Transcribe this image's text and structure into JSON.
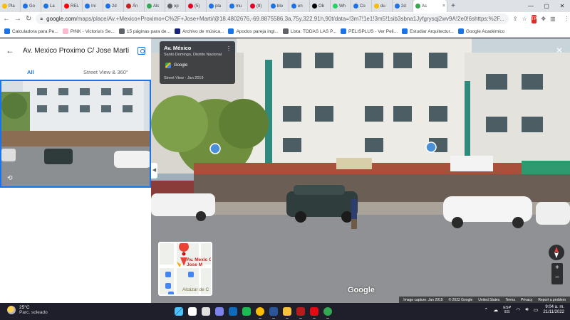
{
  "browser": {
    "tabs": [
      {
        "label": "Pla",
        "color": "#fbbc04"
      },
      {
        "label": "Go",
        "color": "#1a73e8"
      },
      {
        "label": "La",
        "color": "#1a73e8"
      },
      {
        "label": "REL",
        "color": "#ff0000"
      },
      {
        "label": "Ini",
        "color": "#1a73e8"
      },
      {
        "label": "2d",
        "color": "#1a73e8"
      },
      {
        "label": "Án",
        "color": "#c5221f"
      },
      {
        "label": "Alc",
        "color": "#34a853"
      },
      {
        "label": "op",
        "color": "#5f6368"
      },
      {
        "label": "(5)",
        "color": "#e60023"
      },
      {
        "label": "pla",
        "color": "#1a73e8"
      },
      {
        "label": "mu",
        "color": "#1a73e8"
      },
      {
        "label": "(8)",
        "color": "#e60023"
      },
      {
        "label": "blo",
        "color": "#1a73e8"
      },
      {
        "label": "en",
        "color": "#1a73e8"
      },
      {
        "label": "Ob",
        "color": "#000000"
      },
      {
        "label": "Wh",
        "color": "#25d366"
      },
      {
        "label": "Co",
        "color": "#1a73e8"
      },
      {
        "label": "du",
        "color": "#fbbc04"
      },
      {
        "label": "2d",
        "color": "#1a73e8"
      },
      {
        "label": "As",
        "color": "#34a853"
      }
    ],
    "active_tab_color": "#34a853",
    "new_tab": "+",
    "window_controls": {
      "minimize": "—",
      "maximize": "▢",
      "close": "✕"
    },
    "url_host": "google.com",
    "url_path": "/maps/place/Av.+Mexico+Proximo+C%2F+Jose+Marti/@18.4802676,-69.8875586,3a,75y,322.91h,90t/data=!3m7!1e1!3m5!1sib3sbna1Jyfgrysqj2wv9A!2e0!6shttps:%2F..."
  },
  "bookmarks": [
    {
      "label": "Calculadora para Pe...",
      "color": "#1a73e8"
    },
    {
      "label": "PINK - Victoria's Se...",
      "color": "#f8bbd0"
    },
    {
      "label": "15 páginas para de...",
      "color": "#5f6368"
    },
    {
      "label": "Archivo de música...",
      "color": "#1a237e"
    },
    {
      "label": "Apodos pareja ingl...",
      "color": "#1a73e8"
    },
    {
      "label": "Lista: TODAS LAS P...",
      "color": "#5f6368"
    },
    {
      "label": "PELISPLUS - Ver Peli...",
      "color": "#1a73e8"
    },
    {
      "label": "Estudiar Arquitectur...",
      "color": "#1a73e8"
    },
    {
      "label": "Google Académico",
      "color": "#1a73e8"
    }
  ],
  "panel": {
    "title": "Av. Mexico Proximo C/ Jose Marti",
    "tabs": [
      {
        "label": "All"
      },
      {
        "label": "Street View & 360°"
      }
    ]
  },
  "streetview": {
    "card_title": "Av. México",
    "card_subtitle": "Santo Domingo, Distrito Nacional",
    "card_google": "Google",
    "card_date": "Street View - Jan 2019",
    "minimap_label": "Av. Mexic C/ Jose M",
    "minimap_alcazar": "Alcázar de C",
    "google_logo": "Google",
    "attribution": [
      "Image capture: Jan 2019",
      "© 2022 Google",
      "United States",
      "Terms",
      "Privacy",
      "Report a problem"
    ],
    "zoom_in": "+",
    "zoom_out": "−"
  },
  "taskbar": {
    "weather_temp": "25°C",
    "weather_desc": "Parc. soleado",
    "lang_1": "ESP",
    "lang_2": "ES",
    "time": "9:04 a. m.",
    "date": "21/11/2022",
    "apps": [
      {
        "name": "start",
        "color": "#4cc2ff"
      },
      {
        "name": "search",
        "color": "#ffffff"
      },
      {
        "name": "task-view",
        "color": "#e0e0e0"
      },
      {
        "name": "teams",
        "color": "#7b83eb"
      },
      {
        "name": "mail",
        "color": "#0f6cbd"
      },
      {
        "name": "spotify",
        "color": "#1db954"
      },
      {
        "name": "chrome",
        "color": "#fbbc04"
      },
      {
        "name": "word",
        "color": "#2b579a"
      },
      {
        "name": "file-explorer",
        "color": "#f8c13b"
      },
      {
        "name": "app-red",
        "color": "#b71c1c"
      },
      {
        "name": "netflix",
        "color": "#e50914"
      },
      {
        "name": "chrome-profile",
        "color": "#34a853"
      }
    ]
  }
}
